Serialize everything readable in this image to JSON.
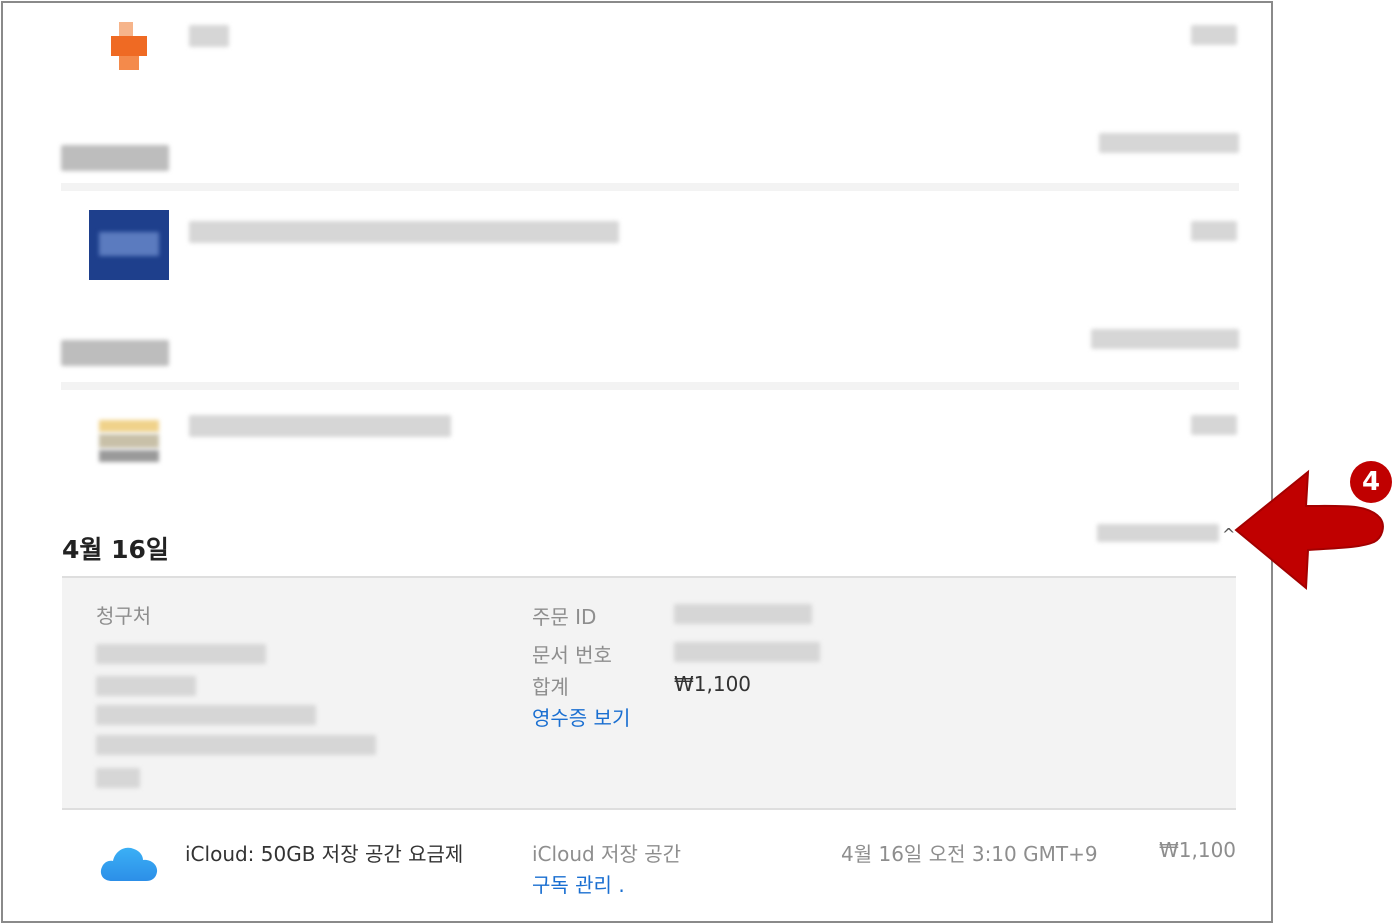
{
  "app_icons": {
    "first": "app-icon",
    "second": "app-icon",
    "third": "app-icon",
    "icloud": "cloud-icon"
  },
  "section_date": "4월 16일",
  "chevron": "^",
  "details": {
    "billing_label": "청구처",
    "order_id_label": "주문 ID",
    "doc_no_label": "문서 번호",
    "total_label": "합계",
    "total_value": "₩1,100",
    "receipt_link": "영수증 보기"
  },
  "item": {
    "name": "iCloud: 50GB 저장 공간 요금제",
    "category": "iCloud 저장 공간",
    "manage_link": "구독 관리 .",
    "datetime": "4월 16일 오전 3:10 GMT+9",
    "price": "₩1,100"
  },
  "annotation": {
    "badge_number": "4",
    "arrow_color": "#c00000"
  }
}
